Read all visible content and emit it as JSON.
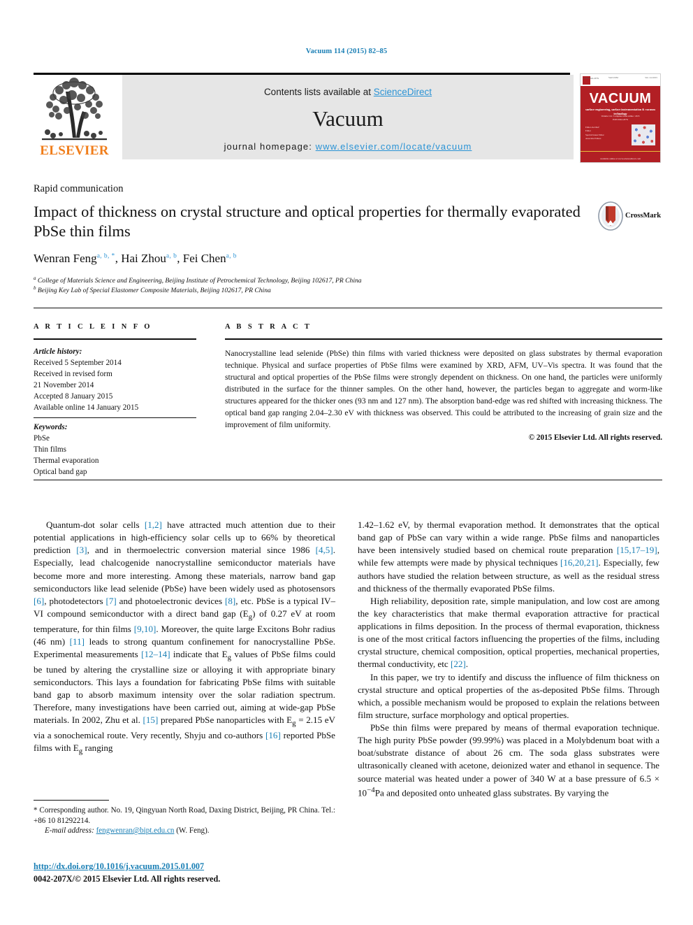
{
  "running_head": "Vacuum 114 (2015) 82–85",
  "masthead": {
    "publisher_logo_name": "elsevier-tree-logo",
    "publisher_wordmark": "ELSEVIER",
    "contents_prefix": "Contents lists available at ",
    "contents_link": "ScienceDirect",
    "journal_name": "Vacuum",
    "homepage_prefix": "journal homepage: ",
    "homepage_url": "www.elsevier.com/locate/vacuum",
    "cover": {
      "title": "VACUUM",
      "subtitle": "surface engineering, surface instrumentation & vacuum technology",
      "subtitle2": "Volume 114 / Complete issue online / 2015\nISSN 0042-207X",
      "top_left": "ISSN 0042-207X",
      "top_center": "VACUUM",
      "top_right": "Vol. 114 2015",
      "editors": "Editor-in-Chief\nEditor\nSpecial Issues Editor\nAssociate Editors",
      "editor_names": "R.J. Reid\nD. Hoffman\nH.E. Elsayed-Ali\nW. Gissler\nM. Hirscher\nP.J. Kelly",
      "footer": "available online at www.sciencedirect.com",
      "accent_color": "#b21f24"
    }
  },
  "article": {
    "kind": "Rapid communication",
    "title": "Impact of thickness on crystal structure and optical properties for thermally evaporated PbSe thin films",
    "authors": [
      {
        "name": "Wenran Feng",
        "marks": "a, b, *"
      },
      {
        "name": "Hai Zhou",
        "marks": "a, b"
      },
      {
        "name": "Fei Chen",
        "marks": "a, b"
      }
    ],
    "affiliations": [
      {
        "mark": "a",
        "text": "College of Materials Science and Engineering, Beijing Institute of Petrochemical Technology, Beijing 102617, PR China"
      },
      {
        "mark": "b",
        "text": "Beijing Key Lab of Special Elastomer Composite Materials, Beijing 102617, PR China"
      }
    ],
    "crossmark_label": "CrossMark"
  },
  "info": {
    "heading": "A R T I C L E  I N F O",
    "history_label": "Article history:",
    "history": [
      "Received 5 September 2014",
      "Received in revised form",
      "21 November 2014",
      "Accepted 8 January 2015",
      "Available online 14 January 2015"
    ],
    "keywords_label": "Keywords:",
    "keywords": [
      "PbSe",
      "Thin films",
      "Thermal evaporation",
      "Optical band gap"
    ]
  },
  "abstract": {
    "heading": "A B S T R A C T",
    "text": "Nanocrystalline lead selenide (PbSe) thin films with varied thickness were deposited on glass substrates by thermal evaporation technique. Physical and surface properties of PbSe films were examined by XRD, AFM, UV–Vis spectra. It was found that the structural and optical properties of the PbSe films were strongly dependent on thickness. On one hand, the particles were uniformly distributed in the surface for the thinner samples. On the other hand, however, the particles began to aggregate and worm-like structures appeared for the thicker ones (93 nm and 127 nm). The absorption band-edge was red shifted with increasing thickness. The optical band gap ranging 2.04–2.30 eV with thickness was observed. This could be attributed to the increasing of grain size and the improvement of film uniformity.",
    "copyright": "© 2015 Elsevier Ltd. All rights reserved."
  },
  "body": {
    "left_paragraph_1": "Quantum-dot solar cells [1,2] have attracted much attention due to their potential applications in high-efficiency solar cells up to 66% by theoretical prediction [3], and in thermoelectric conversion material since 1986 [4,5]. Especially, lead chalcogenide nanocrystalline semiconductor materials have become more and more interesting. Among these materials, narrow band gap semiconductors like lead selenide (PbSe) have been widely used as photosensors [6], photodetectors [7] and photoelectronic devices [8], etc. PbSe is a typical IV–VI compound semiconductor with a direct band gap (Eg) of 0.27 eV at room temperature, for thin films [9,10]. Moreover, the quite large Excitons Bohr radius (46 nm) [11] leads to strong quantum confinement for nanocrystalline PbSe. Experimental measurements [12–14] indicate that Eg values of PbSe films could be tuned by altering the crystalline size or alloying it with appropriate binary semiconductors. This lays a foundation for fabricating PbSe films with suitable band gap to absorb maximum intensity over the solar radiation spectrum. Therefore, many investigations have been carried out, aiming at wide-gap PbSe materials. In 2002, Zhu et al. [15] prepared PbSe nanoparticles with Eg = 2.15 eV via a sonochemical route. Very recently, Shyju and co-authors [16] reported PbSe films with Eg ranging",
    "right_paragraph_1": "1.42–1.62 eV, by thermal evaporation method. It demonstrates that the optical band gap of PbSe can vary within a wide range. PbSe films and nanoparticles have been intensively studied based on chemical route preparation [15,17–19], while few attempts were made by physical techniques [16,20,21]. Especially, few authors have studied the relation between structure, as well as the residual stress and thickness of the thermally evaporated PbSe films.",
    "right_paragraph_2": "High reliability, deposition rate, simple manipulation, and low cost are among the key characteristics that make thermal evaporation attractive for practical applications in films deposition. In the process of thermal evaporation, thickness is one of the most critical factors influencing the properties of the films, including crystal structure, chemical composition, optical properties, mechanical properties, thermal conductivity, etc [22].",
    "right_paragraph_3": "In this paper, we try to identify and discuss the influence of film thickness on crystal structure and optical properties of the as-deposited PbSe films. Through which, a possible mechanism would be proposed to explain the relations between film structure, surface morphology and optical properties.",
    "right_paragraph_4": "PbSe thin films were prepared by means of thermal evaporation technique. The high purity PbSe powder (99.99%) was placed in a Molybdenum boat with a boat/substrate distance of about 26 cm. The soda glass substrates were ultrasonically cleaned with acetone, deionized water and ethanol in sequence. The source material was heated under a power of 340 W at a base pressure of 6.5 × 10−4Pa and deposited onto unheated glass substrates. By varying the"
  },
  "footer": {
    "corresponding": "* Corresponding author. No. 19, Qingyuan North Road, Daxing District, Beijing, PR China. Tel.: +86 10 81292214.",
    "email_label": "E-mail address:",
    "email": "fengwenran@bipt.edu.cn",
    "email_suffix": "(W. Feng).",
    "doi": "http://dx.doi.org/10.1016/j.vacuum.2015.01.007",
    "issn": "0042-207X/© 2015 Elsevier Ltd. All rights reserved."
  },
  "colors": {
    "link": "#1a7fb5",
    "sciencedirect": "#2a93d5",
    "elsevier_orange": "#f07d1a",
    "cover_red": "#b21f24"
  }
}
